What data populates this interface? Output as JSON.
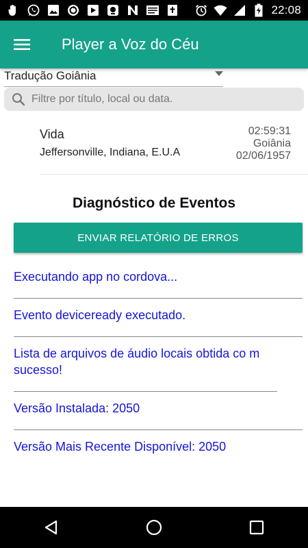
{
  "status_bar": {
    "time": "22:08",
    "left_icons": [
      "hand-icon",
      "whatsapp-icon",
      "image-icon",
      "sync-icon",
      "media-icon",
      "bot-icon",
      "news-icon",
      "card-icon",
      "bible-icon"
    ],
    "right_icons": [
      "alarm-icon",
      "wifi-icon",
      "signal-icon",
      "battery-charging-icon"
    ]
  },
  "app_bar": {
    "title": "Player a Voz do Céu",
    "menu_icon": "hamburger-menu-icon",
    "color": "#15a28a"
  },
  "translation": {
    "selected": "Tradução Goiânia"
  },
  "search": {
    "placeholder": "Filtre por título, local ou data."
  },
  "recording": {
    "title": "Vida",
    "location": "Jeffersonville, Indiana, E.U.A",
    "duration": "02:59:31",
    "translation": "Goiânia",
    "date": "02/06/1957"
  },
  "diagnostics": {
    "title": "Diagnóstico de Eventos",
    "report_button": "ENVIAR RELATÓRIO DE ERROS",
    "events": [
      "Executando app no cordova...",
      "Evento deviceready executado.",
      "Lista de arquivos de áudio locais obtida co m sucesso!",
      "Versão Instalada: 2050",
      "Versão Mais Recente Disponível: 2050"
    ],
    "event_color": "#1515d8"
  },
  "nav_bar": {
    "buttons": [
      "back-icon",
      "home-icon",
      "recents-icon"
    ]
  }
}
